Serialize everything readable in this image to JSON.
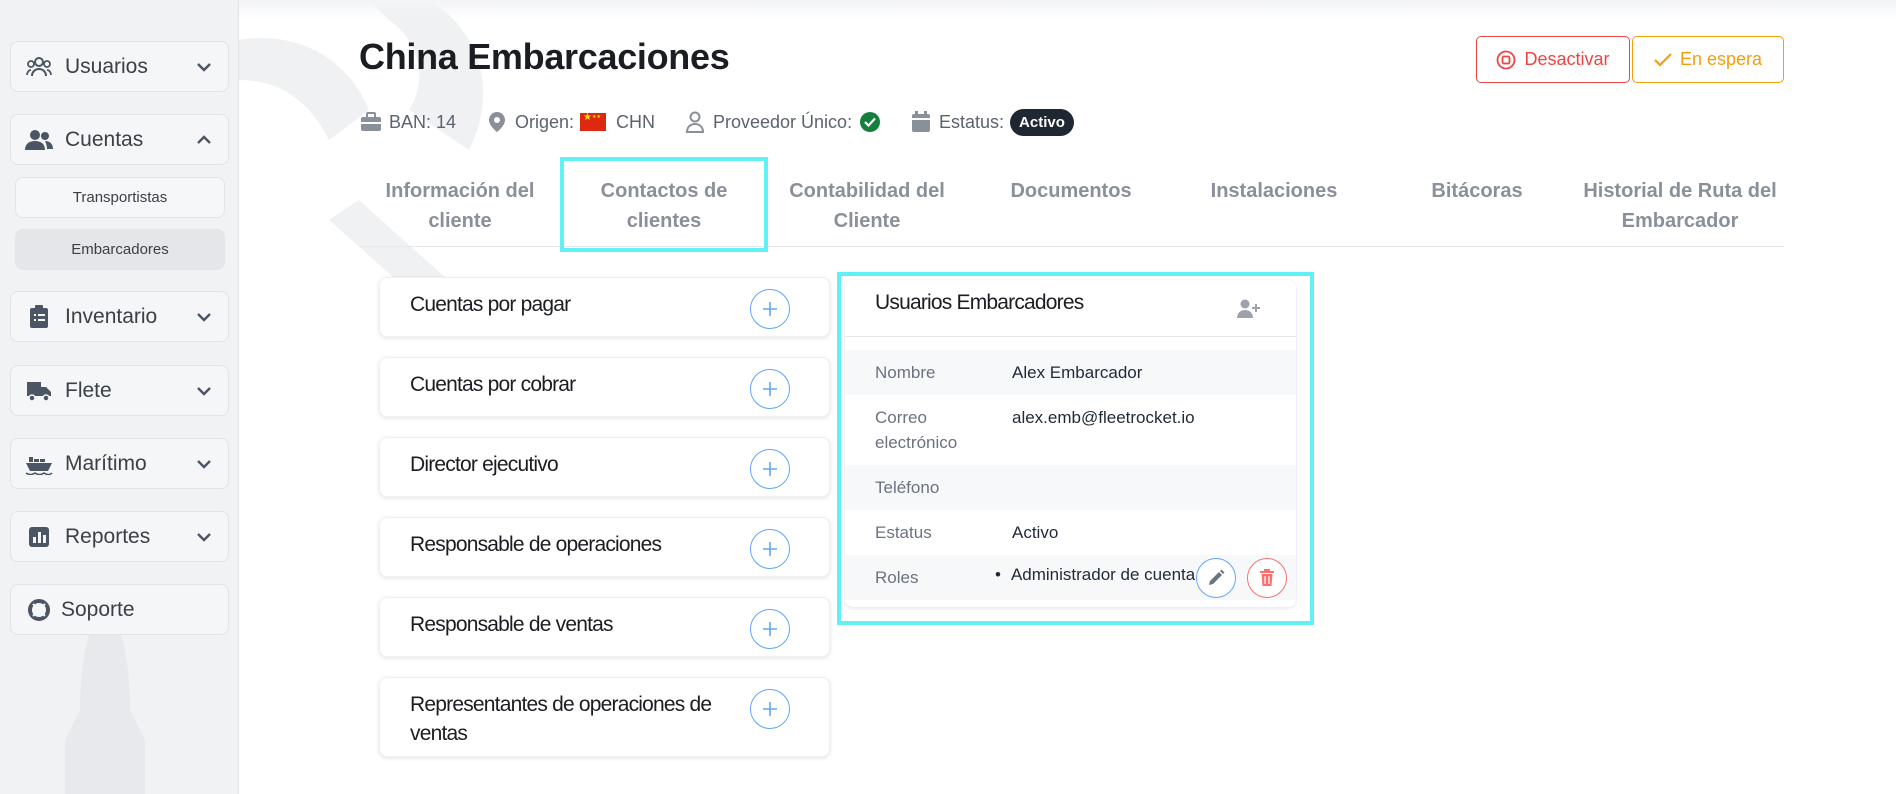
{
  "sidebar": {
    "items": [
      {
        "label": "Usuarios",
        "icon": "users-icon"
      },
      {
        "label": "Cuentas",
        "icon": "accounts-icon"
      },
      {
        "label": "Inventario",
        "icon": "clipboard-icon"
      },
      {
        "label": "Flete",
        "icon": "truck-icon"
      },
      {
        "label": "Marítimo",
        "icon": "ship-icon"
      },
      {
        "label": "Reportes",
        "icon": "chart-icon"
      },
      {
        "label": "Soporte",
        "icon": "lifebuoy-icon"
      }
    ],
    "subitems": [
      {
        "label": "Transportistas"
      },
      {
        "label": "Embarcadores"
      }
    ]
  },
  "page": {
    "title": "China Embarcaciones",
    "ban": "BAN: 14",
    "origin_label": "Origen:",
    "origin_value": "CHN",
    "provider_label": "Proveedor Único:",
    "status_label": "Estatus:",
    "status_value": "Activo"
  },
  "actions": {
    "deactivate": "Desactivar",
    "wait": "En espera"
  },
  "tabs": [
    {
      "label": "Información del cliente"
    },
    {
      "label": "Contactos de clientes"
    },
    {
      "label": "Contabilidad del Cliente"
    },
    {
      "label": "Documentos"
    },
    {
      "label": "Instalaciones"
    },
    {
      "label": "Bitácoras"
    },
    {
      "label": "Historial de Ruta del Embarcador"
    }
  ],
  "contacts": [
    {
      "title": "Cuentas por pagar"
    },
    {
      "title": "Cuentas por cobrar"
    },
    {
      "title": "Director ejecutivo"
    },
    {
      "title": "Responsable de operaciones"
    },
    {
      "title": "Responsable de ventas"
    },
    {
      "title": "Representantes de operaciones de ventas"
    }
  ],
  "users_panel": {
    "title": "Usuarios Embarcadores",
    "fields": {
      "name_label": "Nombre",
      "name_value": "Alex Embarcador",
      "email_label": "Correo electrónico",
      "email_value": "alex.emb@fleetrocket.io",
      "phone_label": "Teléfono",
      "phone_value": "",
      "status_label": "Estatus",
      "status_value": "Activo",
      "roles_label": "Roles",
      "roles_value": "Administrador de cuenta"
    }
  },
  "colors": {
    "highlight": "#5ff1f5",
    "danger": "#ef4444",
    "warning": "#f59e0b",
    "primary": "#60a5fa",
    "success": "#15803d"
  }
}
